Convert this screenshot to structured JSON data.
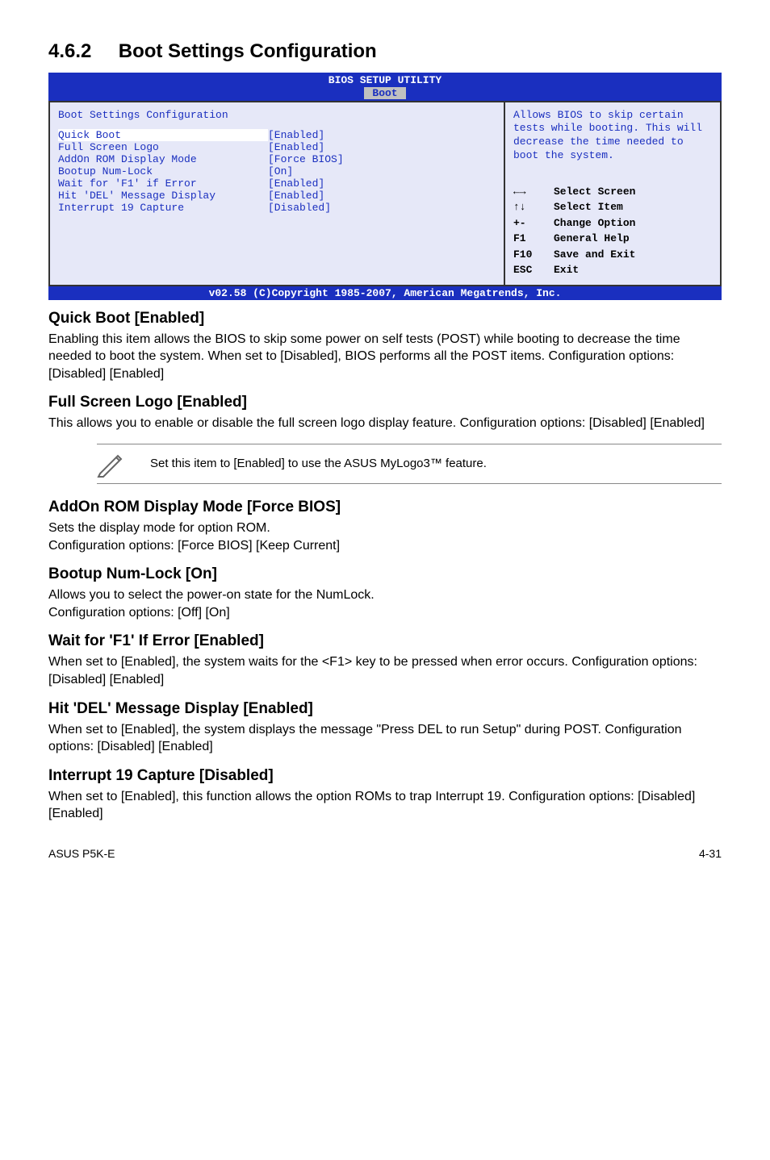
{
  "section": {
    "number": "4.6.2",
    "title": "Boot Settings Configuration"
  },
  "bios": {
    "header": "BIOS SETUP UTILITY",
    "tab": "Boot",
    "panel_title": "Boot Settings Configuration",
    "items": [
      {
        "label": "Quick Boot",
        "value": "[Enabled]"
      },
      {
        "label": "Full Screen Logo",
        "value": "[Enabled]"
      },
      {
        "label": "AddOn ROM Display Mode",
        "value": "[Force BIOS]"
      },
      {
        "label": "Bootup Num-Lock",
        "value": "[On]"
      },
      {
        "label": "Wait for 'F1' if Error",
        "value": "[Enabled]"
      },
      {
        "label": "Hit 'DEL' Message Display",
        "value": "[Enabled]"
      },
      {
        "label": "Interrupt 19 Capture",
        "value": "[Disabled]"
      }
    ],
    "help": "Allows BIOS to skip certain tests while booting. This will decrease the time needed to boot the system.",
    "keys": [
      {
        "sym": "←→",
        "desc": "Select Screen"
      },
      {
        "sym": "↑↓",
        "desc": "Select Item"
      },
      {
        "sym": "+-",
        "desc": "Change Option"
      },
      {
        "sym": "F1",
        "desc": "General Help"
      },
      {
        "sym": "F10",
        "desc": "Save and Exit"
      },
      {
        "sym": "ESC",
        "desc": "Exit"
      }
    ],
    "footer": "v02.58 (C)Copyright 1985-2007, American Megatrends, Inc."
  },
  "items": {
    "quick_boot": {
      "heading": "Quick Boot [Enabled]",
      "text": "Enabling this item allows the BIOS to skip some power on self tests (POST) while booting to decrease the time needed to boot the system. When set to [Disabled], BIOS performs all the POST items. Configuration options: [Disabled] [Enabled]"
    },
    "full_screen_logo": {
      "heading": "Full Screen Logo [Enabled]",
      "text": "This allows you to enable or disable the full screen logo display feature. Configuration options: [Disabled] [Enabled]"
    },
    "note": "Set this item to [Enabled] to use the ASUS MyLogo3™ feature.",
    "addon_rom": {
      "heading": "AddOn ROM Display Mode [Force BIOS]",
      "text": "Sets the display mode for option ROM.\nConfiguration options: [Force BIOS] [Keep Current]"
    },
    "numlock": {
      "heading": "Bootup Num-Lock [On]",
      "text": "Allows you to select the power-on state for the NumLock.\nConfiguration options: [Off] [On]"
    },
    "wait_f1": {
      "heading": "Wait for 'F1' If Error [Enabled]",
      "text": "When set to [Enabled], the system waits for the <F1> key to be pressed when error occurs. Configuration options: [Disabled] [Enabled]"
    },
    "hit_del": {
      "heading": "Hit 'DEL' Message Display [Enabled]",
      "text": "When set to [Enabled], the system displays the message \"Press DEL to run Setup\" during POST. Configuration options: [Disabled] [Enabled]"
    },
    "int19": {
      "heading": "Interrupt 19 Capture [Disabled]",
      "text": "When set to [Enabled], this function allows the option ROMs to trap Interrupt 19. Configuration options: [Disabled] [Enabled]"
    }
  },
  "footer": {
    "left": "ASUS P5K-E",
    "right": "4-31"
  }
}
